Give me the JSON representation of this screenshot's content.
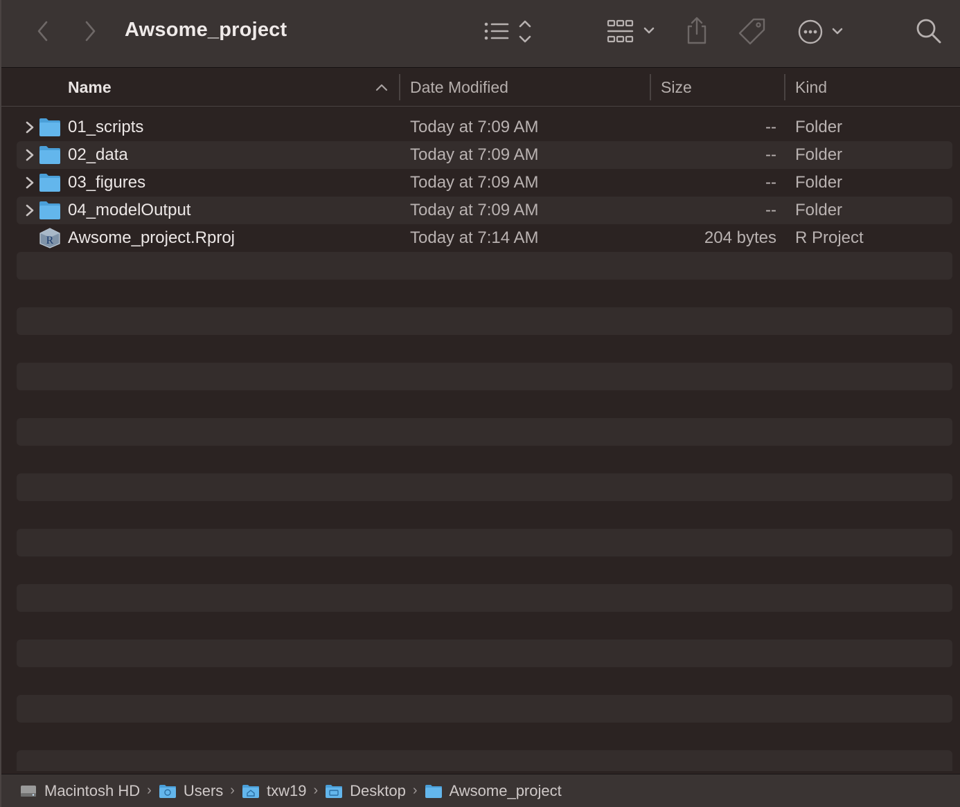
{
  "window": {
    "title": "Awsome_project"
  },
  "toolbar": {
    "back_icon": "chevron-left-icon",
    "forward_icon": "chevron-right-icon",
    "view_icon": "list-view-icon",
    "group_icon": "grid-group-icon",
    "share_icon": "share-icon",
    "tag_icon": "tag-icon",
    "more_icon": "ellipsis-circle-icon",
    "search_icon": "search-icon"
  },
  "columns": {
    "name": "Name",
    "date": "Date Modified",
    "size": "Size",
    "kind": "Kind"
  },
  "files": [
    {
      "name": "01_scripts",
      "date": "Today at 7:09 AM",
      "size": "--",
      "kind": "Folder"
    },
    {
      "name": "02_data",
      "date": "Today at 7:09 AM",
      "size": "--",
      "kind": "Folder"
    },
    {
      "name": "03_figures",
      "date": "Today at 7:09 AM",
      "size": "--",
      "kind": "Folder"
    },
    {
      "name": "04_modelOutput",
      "date": "Today at 7:09 AM",
      "size": "--",
      "kind": "Folder"
    },
    {
      "name": "Awsome_project.Rproj",
      "date": "Today at 7:14 AM",
      "size": "204 bytes",
      "kind": "R Project"
    }
  ],
  "pathbar": [
    {
      "label": "Macintosh HD",
      "icon": "hard-drive-icon"
    },
    {
      "label": "Users",
      "icon": "users-folder-icon"
    },
    {
      "label": "txw19",
      "icon": "home-folder-icon"
    },
    {
      "label": "Desktop",
      "icon": "desktop-folder-icon"
    },
    {
      "label": "Awsome_project",
      "icon": "folder-icon"
    }
  ],
  "colors": {
    "folder_blue": "#5fb4ea",
    "background": "#2b2322",
    "stripe": "#342d2c",
    "toolbar": "#3a3433"
  }
}
